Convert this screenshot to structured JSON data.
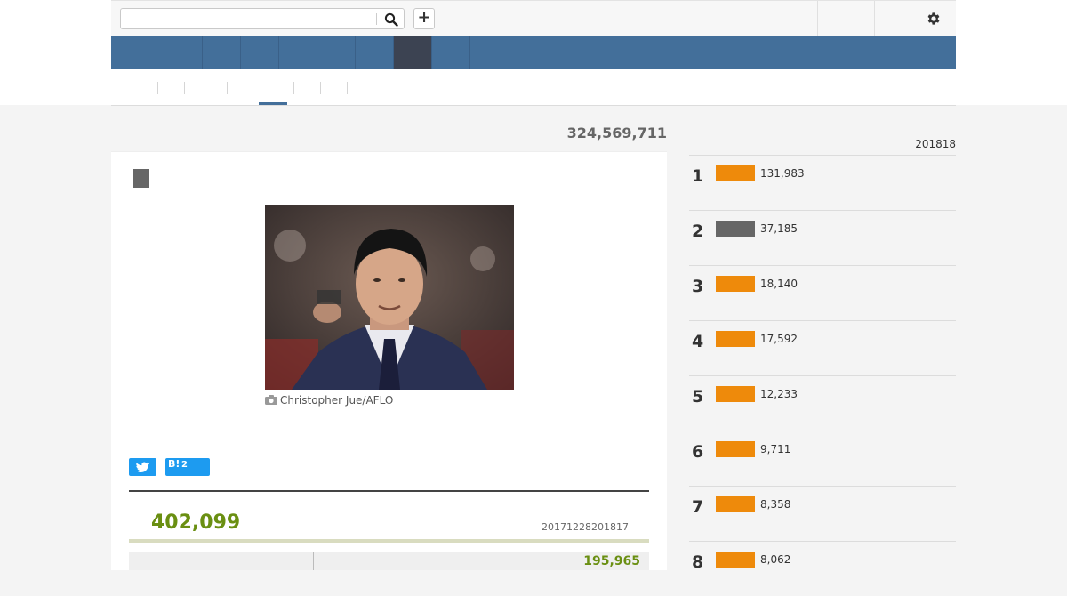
{
  "header": {
    "search": {
      "value": "",
      "placeholder": ""
    },
    "add_label": "+"
  },
  "colors": {
    "nav": "#436f9a",
    "nav_active": "#3c4352",
    "accent_green": "#6a8f12",
    "rank_orange": "#ee8a0b",
    "rank_gray": "#666666",
    "share_blue": "#1d9bf0"
  },
  "total_count": "324,569,711",
  "article": {
    "photo_credit": "Christopher Jue/AFLO",
    "share": {
      "hatena_logo": "B!",
      "hatena_count": "2"
    },
    "stats": {
      "total": "402,099",
      "period": "20171228201817",
      "partial_value": "195,965"
    }
  },
  "ranking": {
    "header": "201818",
    "items": [
      {
        "rank": "1",
        "value": "131,983",
        "bar_color": "#ee8a0b"
      },
      {
        "rank": "2",
        "value": "37,185",
        "bar_color": "#666666"
      },
      {
        "rank": "3",
        "value": "18,140",
        "bar_color": "#ee8a0b"
      },
      {
        "rank": "4",
        "value": "17,592",
        "bar_color": "#ee8a0b"
      },
      {
        "rank": "5",
        "value": "12,233",
        "bar_color": "#ee8a0b"
      },
      {
        "rank": "6",
        "value": "9,711",
        "bar_color": "#ee8a0b"
      },
      {
        "rank": "7",
        "value": "8,358",
        "bar_color": "#ee8a0b"
      },
      {
        "rank": "8",
        "value": "8,062",
        "bar_color": "#ee8a0b"
      }
    ]
  }
}
